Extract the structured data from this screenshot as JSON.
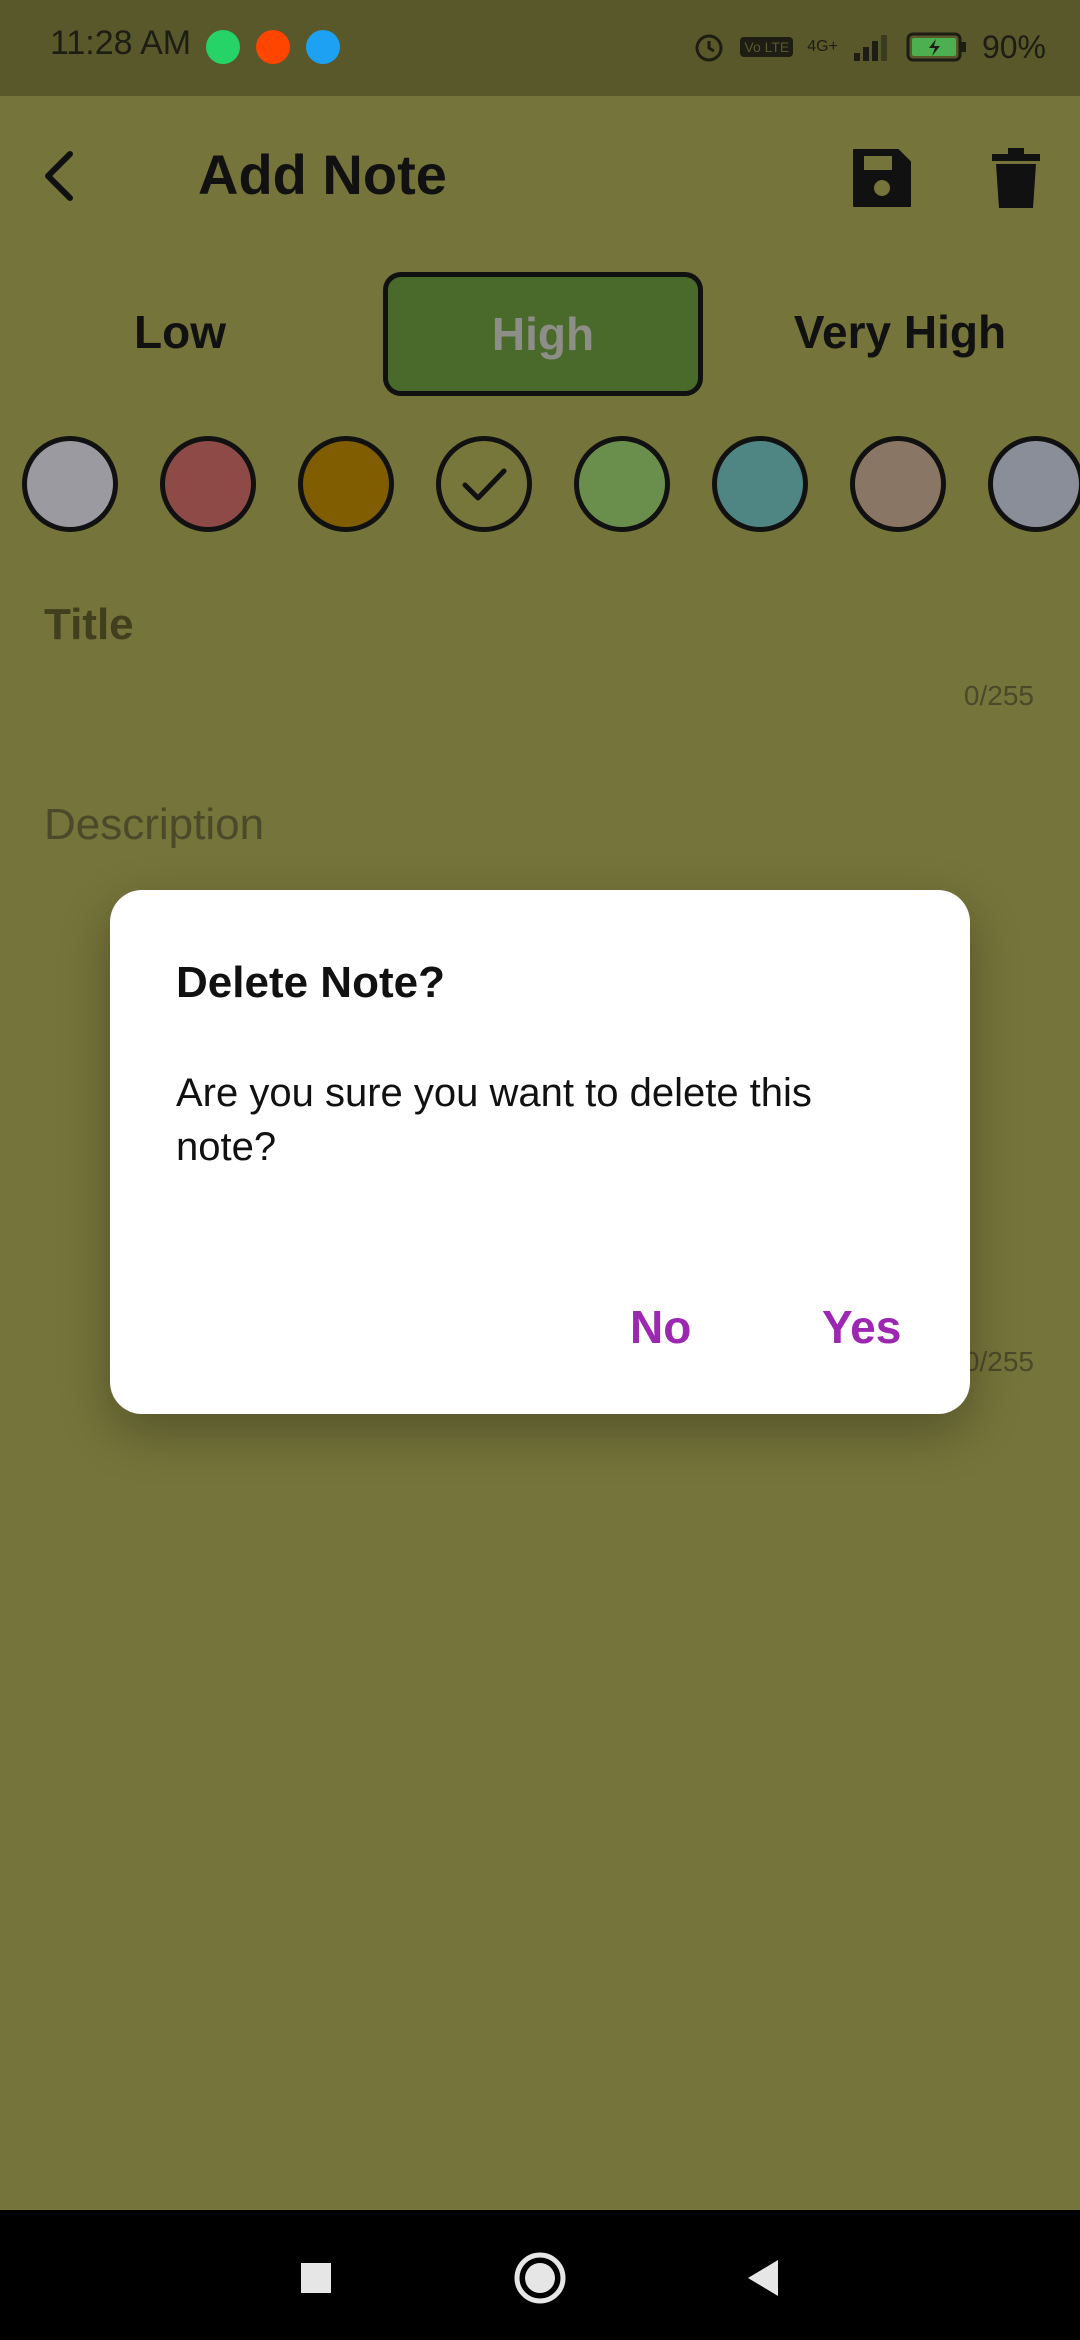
{
  "status_bar": {
    "time": "11:28 AM",
    "battery": "90%",
    "network": "4G+",
    "volte": "Vo LTE"
  },
  "header": {
    "title": "Add Note"
  },
  "priority": {
    "options": [
      "Low",
      "High",
      "Very High"
    ],
    "selected": "High"
  },
  "colors": {
    "swatches": [
      "#9a9aa0",
      "#8d4a47",
      "#7f5d00",
      "#77773c",
      "#6a8f4c",
      "#4f8683",
      "#8a7665",
      "#8a8e99"
    ],
    "selected_index": 3
  },
  "form": {
    "title_placeholder": "Title",
    "title_counter": "0/255",
    "description_placeholder": "Description",
    "description_counter": "0/255"
  },
  "dialog": {
    "title": "Delete Note?",
    "message": "Are you sure you want to delete this note?",
    "no_label": "No",
    "yes_label": "Yes"
  },
  "theme": {
    "background": "#75743a",
    "accent": "#9c27b0",
    "selected_priority": "#4a6a2c"
  }
}
